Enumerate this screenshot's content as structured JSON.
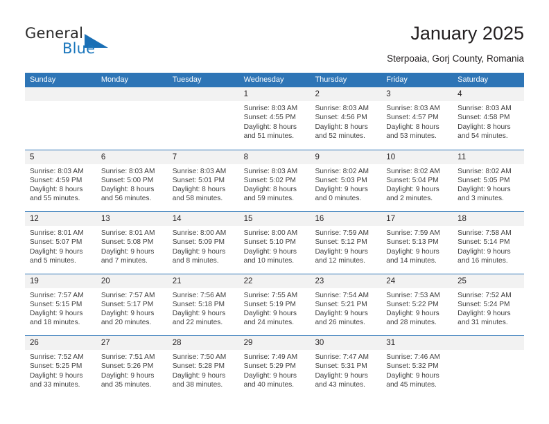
{
  "brand": {
    "name_part1": "General",
    "name_part2": "Blue",
    "triangle_color": "#1a6fb5"
  },
  "header": {
    "title": "January 2025",
    "subtitle": "Sterpoaia, Gorj County, Romania"
  },
  "colors": {
    "header_blue": "#2e75b6",
    "daynum_bg": "#f2f2f2",
    "text": "#231f20",
    "body_text": "#404040"
  },
  "weekdays": [
    "Sunday",
    "Monday",
    "Tuesday",
    "Wednesday",
    "Thursday",
    "Friday",
    "Saturday"
  ],
  "weeks": [
    [
      {
        "day": "",
        "lines": []
      },
      {
        "day": "",
        "lines": []
      },
      {
        "day": "",
        "lines": []
      },
      {
        "day": "1",
        "lines": [
          "Sunrise: 8:03 AM",
          "Sunset: 4:55 PM",
          "Daylight: 8 hours",
          "and 51 minutes."
        ]
      },
      {
        "day": "2",
        "lines": [
          "Sunrise: 8:03 AM",
          "Sunset: 4:56 PM",
          "Daylight: 8 hours",
          "and 52 minutes."
        ]
      },
      {
        "day": "3",
        "lines": [
          "Sunrise: 8:03 AM",
          "Sunset: 4:57 PM",
          "Daylight: 8 hours",
          "and 53 minutes."
        ]
      },
      {
        "day": "4",
        "lines": [
          "Sunrise: 8:03 AM",
          "Sunset: 4:58 PM",
          "Daylight: 8 hours",
          "and 54 minutes."
        ]
      }
    ],
    [
      {
        "day": "5",
        "lines": [
          "Sunrise: 8:03 AM",
          "Sunset: 4:59 PM",
          "Daylight: 8 hours",
          "and 55 minutes."
        ]
      },
      {
        "day": "6",
        "lines": [
          "Sunrise: 8:03 AM",
          "Sunset: 5:00 PM",
          "Daylight: 8 hours",
          "and 56 minutes."
        ]
      },
      {
        "day": "7",
        "lines": [
          "Sunrise: 8:03 AM",
          "Sunset: 5:01 PM",
          "Daylight: 8 hours",
          "and 58 minutes."
        ]
      },
      {
        "day": "8",
        "lines": [
          "Sunrise: 8:03 AM",
          "Sunset: 5:02 PM",
          "Daylight: 8 hours",
          "and 59 minutes."
        ]
      },
      {
        "day": "9",
        "lines": [
          "Sunrise: 8:02 AM",
          "Sunset: 5:03 PM",
          "Daylight: 9 hours",
          "and 0 minutes."
        ]
      },
      {
        "day": "10",
        "lines": [
          "Sunrise: 8:02 AM",
          "Sunset: 5:04 PM",
          "Daylight: 9 hours",
          "and 2 minutes."
        ]
      },
      {
        "day": "11",
        "lines": [
          "Sunrise: 8:02 AM",
          "Sunset: 5:05 PM",
          "Daylight: 9 hours",
          "and 3 minutes."
        ]
      }
    ],
    [
      {
        "day": "12",
        "lines": [
          "Sunrise: 8:01 AM",
          "Sunset: 5:07 PM",
          "Daylight: 9 hours",
          "and 5 minutes."
        ]
      },
      {
        "day": "13",
        "lines": [
          "Sunrise: 8:01 AM",
          "Sunset: 5:08 PM",
          "Daylight: 9 hours",
          "and 7 minutes."
        ]
      },
      {
        "day": "14",
        "lines": [
          "Sunrise: 8:00 AM",
          "Sunset: 5:09 PM",
          "Daylight: 9 hours",
          "and 8 minutes."
        ]
      },
      {
        "day": "15",
        "lines": [
          "Sunrise: 8:00 AM",
          "Sunset: 5:10 PM",
          "Daylight: 9 hours",
          "and 10 minutes."
        ]
      },
      {
        "day": "16",
        "lines": [
          "Sunrise: 7:59 AM",
          "Sunset: 5:12 PM",
          "Daylight: 9 hours",
          "and 12 minutes."
        ]
      },
      {
        "day": "17",
        "lines": [
          "Sunrise: 7:59 AM",
          "Sunset: 5:13 PM",
          "Daylight: 9 hours",
          "and 14 minutes."
        ]
      },
      {
        "day": "18",
        "lines": [
          "Sunrise: 7:58 AM",
          "Sunset: 5:14 PM",
          "Daylight: 9 hours",
          "and 16 minutes."
        ]
      }
    ],
    [
      {
        "day": "19",
        "lines": [
          "Sunrise: 7:57 AM",
          "Sunset: 5:15 PM",
          "Daylight: 9 hours",
          "and 18 minutes."
        ]
      },
      {
        "day": "20",
        "lines": [
          "Sunrise: 7:57 AM",
          "Sunset: 5:17 PM",
          "Daylight: 9 hours",
          "and 20 minutes."
        ]
      },
      {
        "day": "21",
        "lines": [
          "Sunrise: 7:56 AM",
          "Sunset: 5:18 PM",
          "Daylight: 9 hours",
          "and 22 minutes."
        ]
      },
      {
        "day": "22",
        "lines": [
          "Sunrise: 7:55 AM",
          "Sunset: 5:19 PM",
          "Daylight: 9 hours",
          "and 24 minutes."
        ]
      },
      {
        "day": "23",
        "lines": [
          "Sunrise: 7:54 AM",
          "Sunset: 5:21 PM",
          "Daylight: 9 hours",
          "and 26 minutes."
        ]
      },
      {
        "day": "24",
        "lines": [
          "Sunrise: 7:53 AM",
          "Sunset: 5:22 PM",
          "Daylight: 9 hours",
          "and 28 minutes."
        ]
      },
      {
        "day": "25",
        "lines": [
          "Sunrise: 7:52 AM",
          "Sunset: 5:24 PM",
          "Daylight: 9 hours",
          "and 31 minutes."
        ]
      }
    ],
    [
      {
        "day": "26",
        "lines": [
          "Sunrise: 7:52 AM",
          "Sunset: 5:25 PM",
          "Daylight: 9 hours",
          "and 33 minutes."
        ]
      },
      {
        "day": "27",
        "lines": [
          "Sunrise: 7:51 AM",
          "Sunset: 5:26 PM",
          "Daylight: 9 hours",
          "and 35 minutes."
        ]
      },
      {
        "day": "28",
        "lines": [
          "Sunrise: 7:50 AM",
          "Sunset: 5:28 PM",
          "Daylight: 9 hours",
          "and 38 minutes."
        ]
      },
      {
        "day": "29",
        "lines": [
          "Sunrise: 7:49 AM",
          "Sunset: 5:29 PM",
          "Daylight: 9 hours",
          "and 40 minutes."
        ]
      },
      {
        "day": "30",
        "lines": [
          "Sunrise: 7:47 AM",
          "Sunset: 5:31 PM",
          "Daylight: 9 hours",
          "and 43 minutes."
        ]
      },
      {
        "day": "31",
        "lines": [
          "Sunrise: 7:46 AM",
          "Sunset: 5:32 PM",
          "Daylight: 9 hours",
          "and 45 minutes."
        ]
      },
      {
        "day": "",
        "lines": []
      }
    ]
  ]
}
